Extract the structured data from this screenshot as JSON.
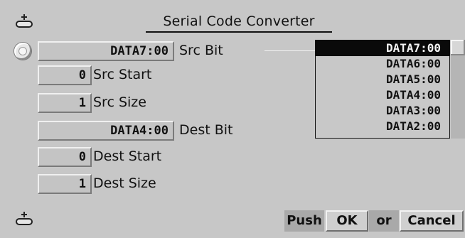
{
  "window": {
    "title": "Serial Code Converter"
  },
  "fields": {
    "src_bit": {
      "value": "DATA7:00",
      "label": "Src Bit"
    },
    "src_start": {
      "value": "0",
      "label": "Src Start"
    },
    "src_size": {
      "value": "1",
      "label": "Src Size"
    },
    "dest_bit": {
      "value": "DATA4:00",
      "label": "Dest Bit"
    },
    "dest_start": {
      "value": "0",
      "label": "Dest Start"
    },
    "dest_size": {
      "value": "1",
      "label": "Dest Size"
    }
  },
  "list": {
    "items": [
      "DATA7:00",
      "DATA6:00",
      "DATA5:00",
      "DATA4:00",
      "DATA3:00",
      "DATA2:00"
    ],
    "selected_index": 0
  },
  "footer": {
    "push_label": "Push",
    "ok_label": "OK",
    "or_label": "or",
    "cancel_label": "Cancel"
  },
  "icons": {
    "top_left": "pin-icon",
    "bottom_left": "pin-icon",
    "radio": "radio-icon"
  },
  "colors": {
    "background": "#c7c7c7",
    "selection": "#0a0a0a",
    "selection_text": "#f4f4f4",
    "push_bg": "#a9a9a9"
  }
}
